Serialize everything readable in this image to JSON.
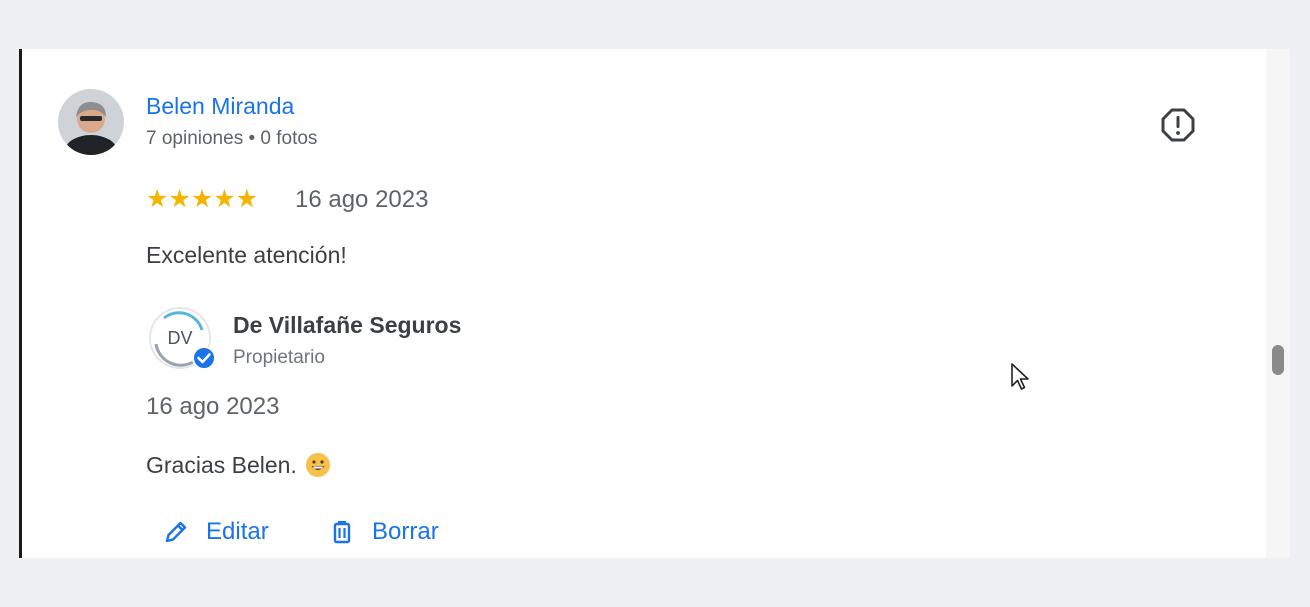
{
  "review": {
    "reviewer": {
      "name": "Belen Miranda",
      "meta": "7 opiniones • 0 fotos"
    },
    "rating": {
      "stars": "★★★★★",
      "value": 5
    },
    "date": "16 ago 2023",
    "text": "Excelente atención!"
  },
  "reply": {
    "owner": {
      "name": "De Villafañe Seguros",
      "role": "Propietario",
      "logo_text": "DV"
    },
    "date": "16 ago 2023",
    "text": "Gracias Belen."
  },
  "actions": {
    "edit_label": "Editar",
    "delete_label": "Borrar"
  },
  "icons": {
    "report": "report-icon",
    "edit": "pencil-icon",
    "delete": "trash-icon",
    "verified": "verified-badge-icon",
    "emoji": "grinning-face-emoji"
  },
  "colors": {
    "link": "#1a73e8",
    "star": "#f4b400",
    "text": "#3c4043",
    "muted": "#5f6368",
    "background": "#eef0f4"
  }
}
